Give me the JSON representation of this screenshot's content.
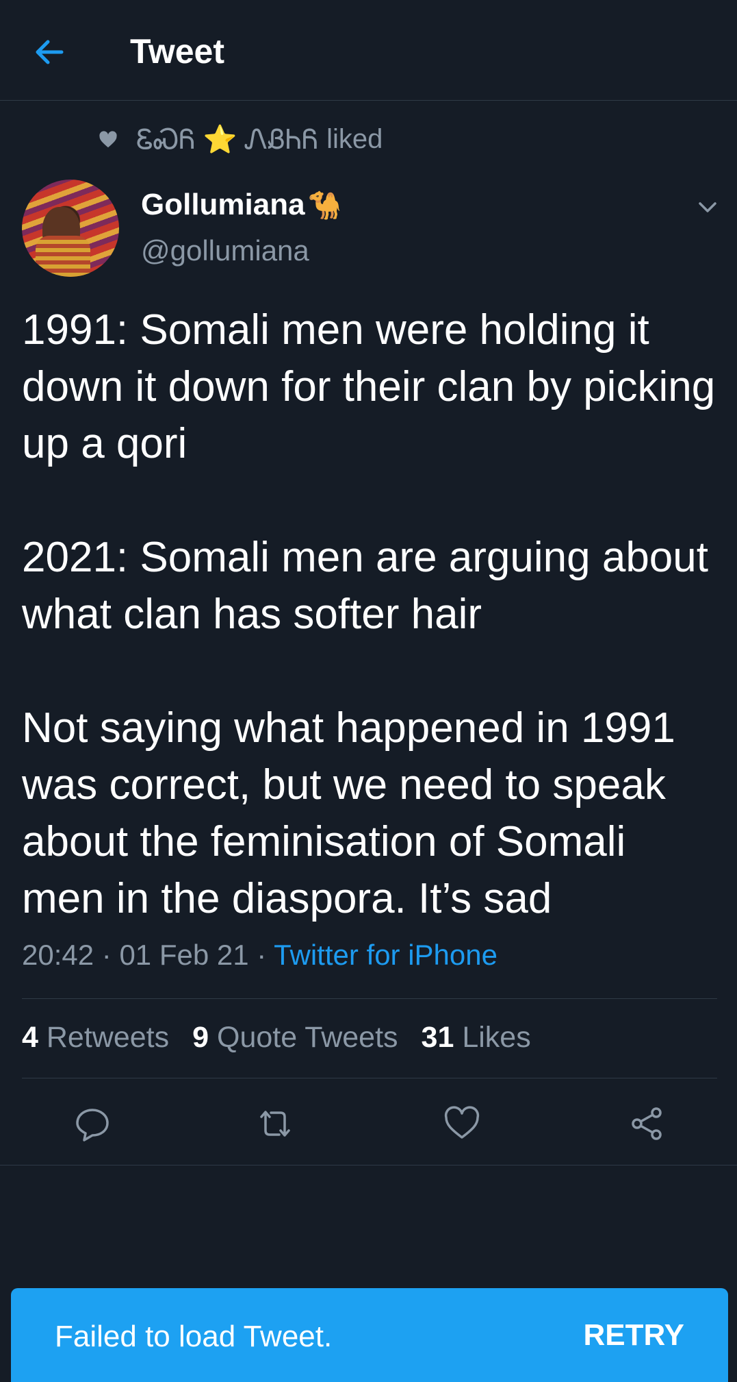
{
  "header": {
    "title": "Tweet",
    "back_icon": "arrow-left-icon"
  },
  "social_context": {
    "names": "ᏋᏍᏲ ⭐ ᏁᏰᏂᏲ",
    "verb": "liked"
  },
  "author": {
    "name": "Gollumiana",
    "emoji": "🐪",
    "handle": "@gollumiana"
  },
  "tweet": {
    "text": "1991: Somali men were holding it down it down for their clan by picking up a qori\n\n2021: Somali men are arguing about what clan has softer hair\n\nNot saying what happened in 1991 was correct, but we need to speak about the feminisation of Somali men in the diaspora. It’s sad",
    "time": "20:42",
    "date": "01 Feb 21",
    "source": "Twitter for iPhone"
  },
  "stats": {
    "retweets_count": "4",
    "retweets_label": "Retweets",
    "quotes_count": "9",
    "quotes_label": "Quote Tweets",
    "likes_count": "31",
    "likes_label": "Likes"
  },
  "actions": [
    "reply-icon",
    "retweet-icon",
    "like-icon",
    "share-icon"
  ],
  "toast": {
    "message": "Failed to load Tweet.",
    "action": "RETRY"
  },
  "colors": {
    "background": "#151c26",
    "accent": "#1d9bf0",
    "muted": "#8b98a6",
    "toast": "#1da1f2"
  }
}
